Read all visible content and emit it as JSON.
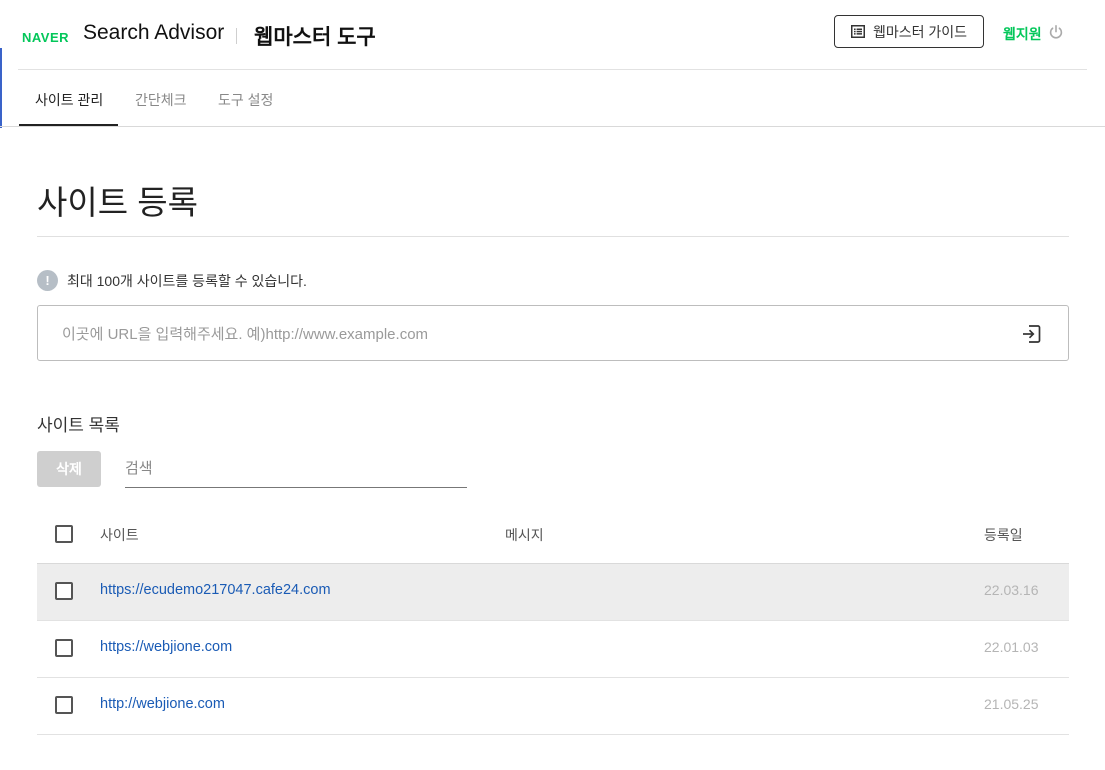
{
  "header": {
    "brand": "NAVER",
    "product": "Search Advisor",
    "subtitle": "웹마스터 도구",
    "guide_button": "웹마스터 가이드",
    "user_name": "웹지원"
  },
  "tabs": [
    {
      "label": "사이트 관리",
      "active": true
    },
    {
      "label": "간단체크",
      "active": false
    },
    {
      "label": "도구 설정",
      "active": false
    }
  ],
  "page": {
    "title": "사이트 등록",
    "notice": "최대 100개 사이트를 등록할 수 있습니다.",
    "url_placeholder": "이곳에 URL을 입력해주세요. 예)http://www.example.com"
  },
  "site_list": {
    "title": "사이트 목록",
    "delete_button": "삭제",
    "search_placeholder": "검색",
    "columns": {
      "site": "사이트",
      "message": "메시지",
      "date": "등록일"
    },
    "rows": [
      {
        "site": "https://ecudemo217047.cafe24.com",
        "message": "",
        "date": "22.03.16"
      },
      {
        "site": "https://webjione.com",
        "message": "",
        "date": "22.01.03"
      },
      {
        "site": "http://webjione.com",
        "message": "",
        "date": "21.05.25"
      }
    ]
  },
  "colors": {
    "naver_green": "#03c75a",
    "link_blue": "#1a5bb5",
    "row_highlight": "#ededed"
  }
}
